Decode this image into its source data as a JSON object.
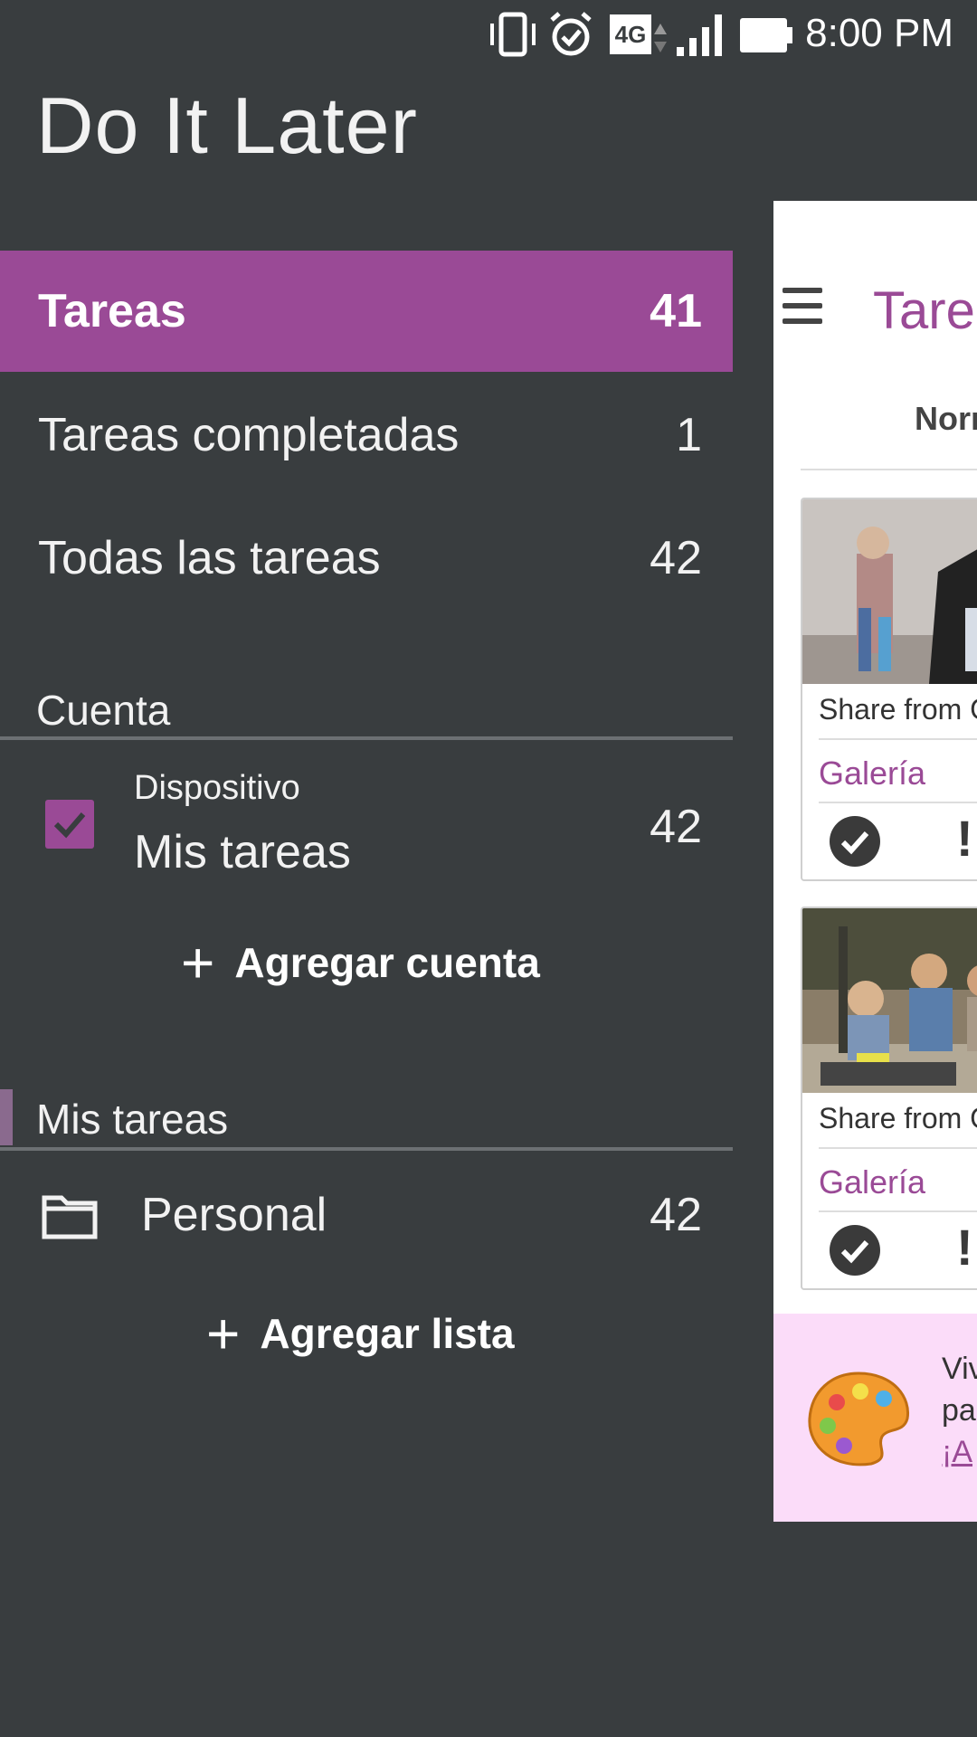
{
  "status_bar": {
    "time": "8:00 PM",
    "network": "4G"
  },
  "app": {
    "title": "Do It Later"
  },
  "drawer": {
    "filters": [
      {
        "label": "Tareas",
        "count": "41",
        "active": true
      },
      {
        "label": "Tareas completadas",
        "count": "1"
      },
      {
        "label": "Todas las tareas",
        "count": "42"
      }
    ],
    "accounts_section": {
      "title": "Cuenta",
      "account": {
        "type": "Dispositivo",
        "name": "Mis tareas",
        "count": "42",
        "checked": true
      },
      "add_label": "Agregar cuenta"
    },
    "lists_section": {
      "title": "Mis tareas",
      "lists": [
        {
          "label": "Personal",
          "count": "42"
        }
      ],
      "add_label": "Agregar lista"
    }
  },
  "panel": {
    "title": "Tarea",
    "sort_label": "Norn",
    "cards": [
      {
        "share": "Share from G",
        "source": "Galería"
      },
      {
        "share": "Share from G",
        "source": "Galería"
      }
    ],
    "promo": {
      "line1": "Viv",
      "line2": "pa",
      "link": "¡A"
    }
  },
  "colors": {
    "accent": "#9a4a96",
    "background": "#393d3f",
    "promo_bg": "#fbdcf9"
  }
}
